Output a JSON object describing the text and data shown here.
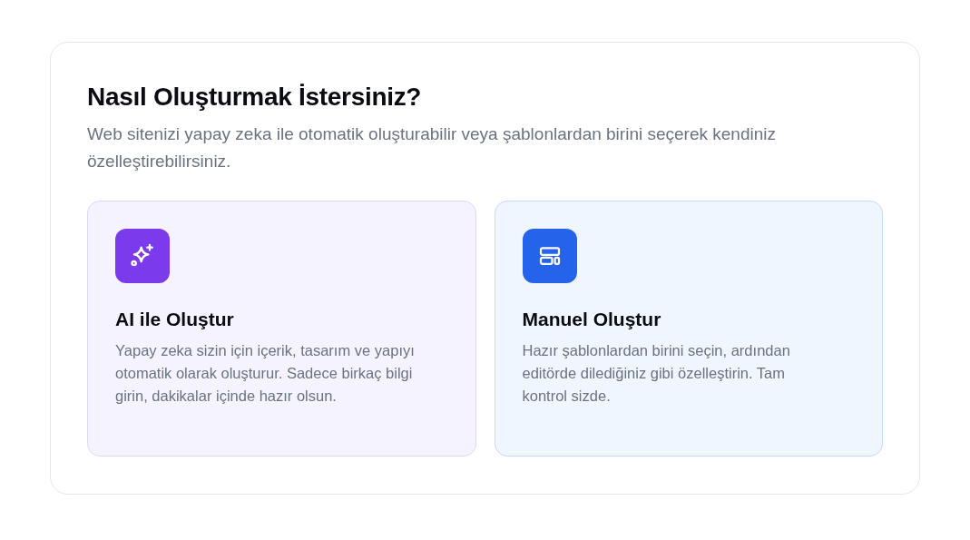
{
  "title": "Nasıl Oluşturmak İstersiniz?",
  "subtitle": "Web sitenizi yapay zeka ile otomatik oluşturabilir veya şablonlardan birini seçerek kendiniz özelleştirebilirsiniz.",
  "options": [
    {
      "kind": "ai",
      "color": "#7c3aed",
      "title": "AI ile Oluştur",
      "description": "Yapay zeka sizin için içerik, tasarım ve yapıyı otomatik olarak oluşturur. Sadece birkaç bilgi girin, dakikalar içinde hazır olsun."
    },
    {
      "kind": "manual",
      "color": "#2563eb",
      "title": "Manuel Oluştur",
      "description": "Hazır şablonlardan birini seçin, ardından editörde dilediğiniz gibi özelleştirin. Tam kontrol sizde."
    }
  ]
}
